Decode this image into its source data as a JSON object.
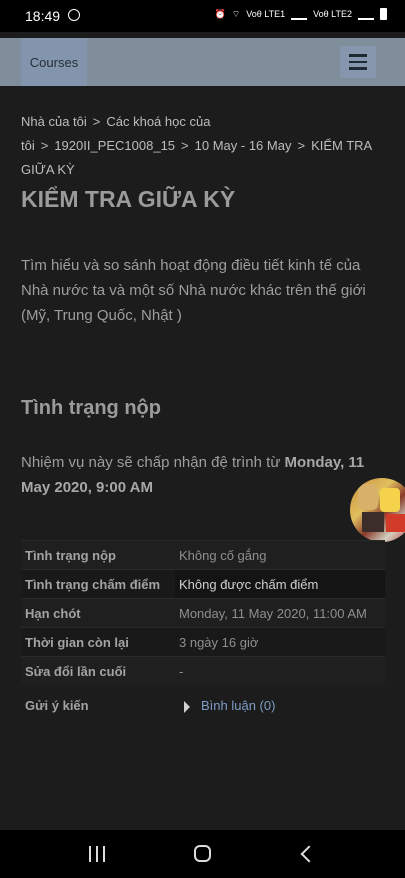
{
  "status_bar": {
    "time": "18:49",
    "sim1_label": "Voθ LTE1",
    "sim2_label": "Voθ LTE2"
  },
  "navbar": {
    "courses_label": "Courses"
  },
  "breadcrumb": [
    "Nhà của tôi",
    "Các khoá học của tôi",
    "1920II_PEC1008_15",
    "10 May - 16 May",
    "KIỂM TRA GIỮA KỲ"
  ],
  "page_title": "KIỂM TRA GIỮA KỲ",
  "description": "Tìm hiểu và so sánh hoạt động điều tiết kinh tế của Nhà nước ta và một số Nhà nước khác trên thế giới (Mỹ, Trung Quốc, Nhật )",
  "submission_heading": "Tình trạng nộp",
  "acceptance": {
    "prefix": "Nhiệm vụ này sẽ chấp nhận đệ trình từ ",
    "date": "Monday, 11 May 2020, 9:00 AM"
  },
  "status_table": [
    {
      "key": "Tình trạng nộp",
      "value": "Không cố gắng"
    },
    {
      "key": "Tình trạng chấm điểm",
      "value": "Không được chấm điểm"
    },
    {
      "key": "Hạn chót",
      "value": "Monday, 11 May 2020, 11:00 AM"
    },
    {
      "key": "Thời gian còn lại",
      "value": "3 ngày 16 giờ"
    },
    {
      "key": "Sửa đổi lần cuối",
      "value": "-"
    }
  ],
  "feedback": {
    "label": "Gửi ý kiến",
    "comment_link": "Bình luận (0)"
  },
  "colors": {
    "background": "#1c1c1d",
    "navbar": "#7f8e9a",
    "link": "#7e9cc4"
  },
  "icons": [
    "messenger-icon",
    "alarm-icon",
    "wifi-icon",
    "signal-icon",
    "battery-icon",
    "hamburger-menu-icon",
    "triangle-right-icon",
    "recent-apps-icon",
    "home-icon",
    "back-icon"
  ]
}
